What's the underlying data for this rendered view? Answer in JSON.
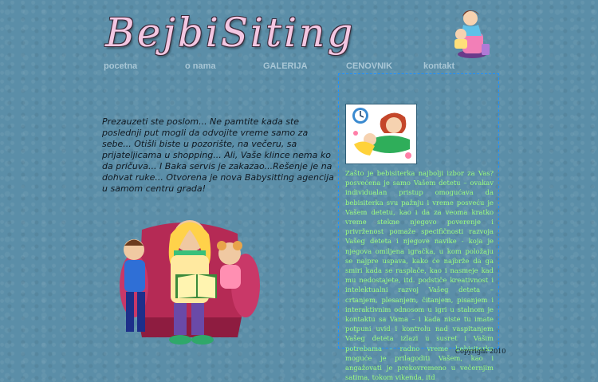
{
  "brand": {
    "logo_text": "BejbiSiting"
  },
  "nav": {
    "items": [
      {
        "label": "pocetna"
      },
      {
        "label": "o nama"
      },
      {
        "label": "GALERIJA"
      },
      {
        "label": "CENOVNIK"
      },
      {
        "label": "kontakt"
      }
    ]
  },
  "main": {
    "intro_text": "Prezauzeti ste poslom... Ne pamtite kada ste poslednji put mogli da odvojite vreme samo za sebe... Otišli biste u pozorište, na večeru, sa prijateljicama u shopping... Ali, Vaše klince nema ko da pričuva... I Baka servis je zakazao...Rešenje je na dohvat ruke... Otvorena je nova Babysitting agencija u samom centru grada!"
  },
  "sidebar": {
    "text": "Zašto je bebisiterka najbolji izbor za Vas? posvećena je samo Vašem detetu – ovakav individualan pristup omogućava da bebisiterka svu pažnju i vreme posveću je Vašem detetu, kao i da za veoma kratko vreme stekne njegovo poverenje i privrženost pomaže specifičnosti razvoja Vašeg deteta i njegove navike - koja je njegova omiljena igračka, u kom položaju se najpre uspava, kako će najbrže da ga smiri kada se rasplače, kao i nasmeje kad mu nedostajete, itd. podstiče kreativnost i intelektualni razvoj Vašeg deteta – crtanjem, plesanjem, čitanjem, pisanjem i interaktivnim odnosom u igri u stalnom je kontaktu sa Vama – i kada niste tu imate potpuni uvid i kontrolu nad vaspitanjem Vašeg deteta izlazi u susret i Vašim potrebama – radno vreme bebisiterke moguće je prilagoditi Vašem, kao i angažovati je prekovremeno u večernjim satima, tokom vikenda, itd"
  },
  "footer": {
    "copyright": "Copyright 2010"
  },
  "colors": {
    "background": "#5b8ea8",
    "nav_link": "#a9c7d6",
    "logo_fill": "#f3c7e2",
    "side_text": "#9dff7e",
    "panel_border": "#1e90ff"
  },
  "icons": {
    "mom_and_child": "mom-child-clipart",
    "mother_reading": "mother-reading-clipart",
    "sitter_playing": "babysitter-clipart"
  }
}
